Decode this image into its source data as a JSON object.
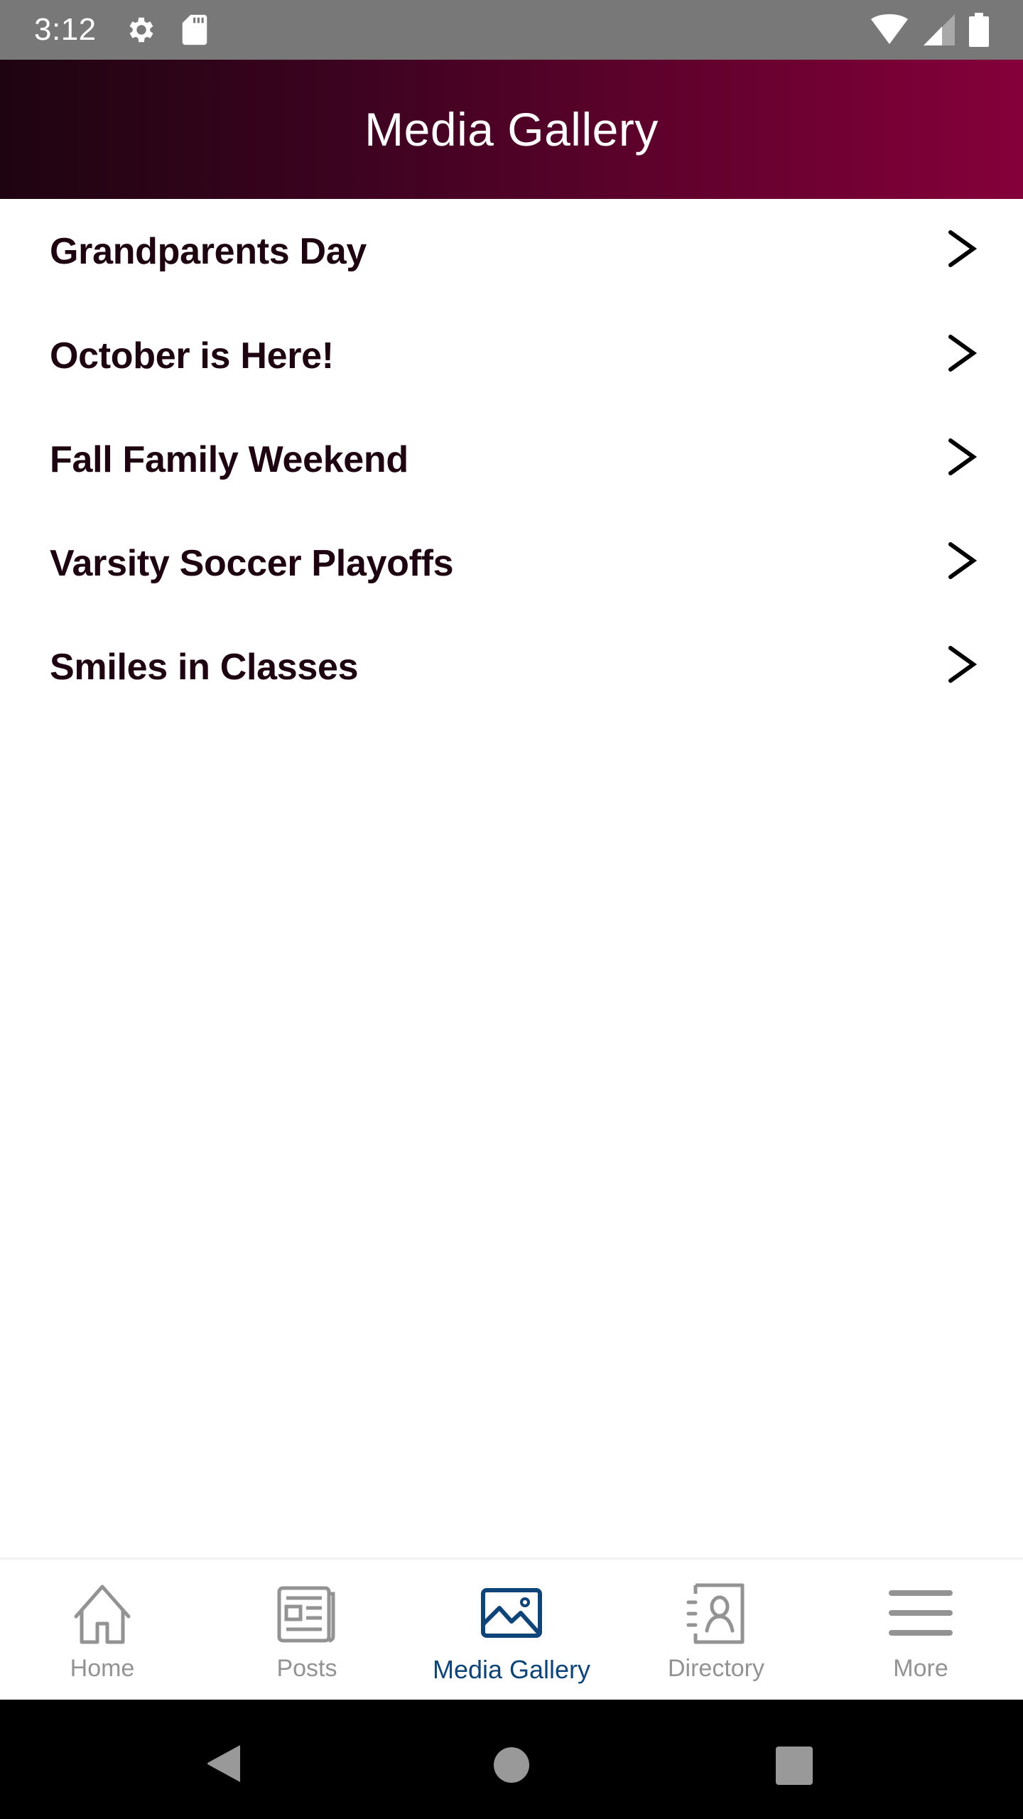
{
  "status_bar": {
    "time": "3:12",
    "left_icons": [
      "settings-icon",
      "sd-card-icon"
    ],
    "right_icons": [
      "wifi-icon",
      "cellular-signal-icon",
      "battery-icon"
    ]
  },
  "header": {
    "title": "Media Gallery",
    "gradient_start": "#1e0410",
    "gradient_end": "#85003a"
  },
  "gallery": {
    "items": [
      {
        "label": "Grandparents Day",
        "icon": "chevron-right-icon"
      },
      {
        "label": "October is Here!",
        "icon": "chevron-right-icon"
      },
      {
        "label": "Fall Family Weekend",
        "icon": "chevron-right-icon"
      },
      {
        "label": "Varsity Soccer Playoffs",
        "icon": "chevron-right-icon"
      },
      {
        "label": "Smiles in Classes",
        "icon": "chevron-right-icon"
      }
    ],
    "text_color": "#1e0410"
  },
  "tab_bar": {
    "active_color": "#0e4477",
    "inactive_color": "#939393",
    "tabs": [
      {
        "label": "Home",
        "icon": "home-icon",
        "active": false
      },
      {
        "label": "Posts",
        "icon": "newspaper-icon",
        "active": false
      },
      {
        "label": "Media Gallery",
        "icon": "image-icon",
        "active": true
      },
      {
        "label": "Directory",
        "icon": "contact-book-icon",
        "active": false
      },
      {
        "label": "More",
        "icon": "menu-icon",
        "active": false
      }
    ]
  },
  "nav_bar": {
    "buttons": [
      "back",
      "home",
      "recents"
    ]
  }
}
